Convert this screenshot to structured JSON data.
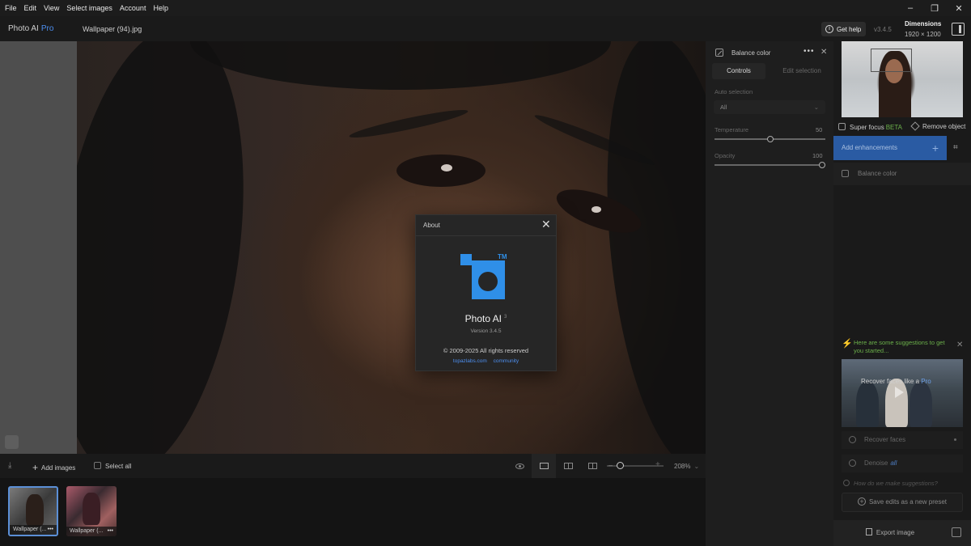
{
  "menu": [
    "File",
    "Edit",
    "View",
    "Select images",
    "Account",
    "Help"
  ],
  "window_controls": {
    "minimize": "–",
    "restore": "❐",
    "close": "✕"
  },
  "titlebar": {
    "app_name": "Photo AI",
    "app_tier": "Pro",
    "file_name": "Wallpaper (94).jpg",
    "get_help": "Get help",
    "version": "v3.4.5",
    "dimensions_label": "Dimensions",
    "dimensions_value": "1920 × 1200"
  },
  "bottombar": {
    "add_images": "Add images",
    "select_all": "Select all",
    "zoom": "208%",
    "zoom_level": 0.2
  },
  "thumbnails": [
    {
      "label": "Wallpaper (...",
      "more": "•••",
      "selected": true
    },
    {
      "label": "Wallpaper (...",
      "more": "•••",
      "selected": false
    }
  ],
  "balance_panel": {
    "title": "Balance color",
    "more": "•••",
    "close": "✕",
    "tabs": [
      "Controls",
      "Edit selection"
    ],
    "auto_selection_label": "Auto selection",
    "auto_selection_value": "All",
    "temperature_label": "Temperature",
    "temperature_value": "50",
    "temperature_level": 0.5,
    "opacity_label": "Opacity",
    "opacity_value": "100",
    "opacity_level": 1.0
  },
  "right_panel": {
    "super_focus": "Super focus",
    "super_focus_badge": "BETA",
    "remove_object": "Remove object",
    "add_enhancements": "Add enhancements",
    "enhancement_item": "Balance color",
    "suggestions_text": "Here are some suggestions to get you started...",
    "video_title": "Recover faces like a",
    "video_title_pro": "Pro",
    "suggestions": [
      "Recover faces",
      "Denoise"
    ],
    "denoise_tag": "all",
    "how_suggestions": "How do we make suggestions?",
    "save_preset": "Save edits as a new preset",
    "export": "Export image"
  },
  "about": {
    "title": "About",
    "close": "✕",
    "trademark": "TM",
    "product": "Photo AI",
    "product_sup": "3",
    "version": "Version 3.4.5",
    "copyright": "© 2009-2025 All rights reserved",
    "link_site": "topazlabs.com",
    "link_community": "community"
  },
  "colors": {
    "accent": "#4d8ff0",
    "add_enhancements_bg": "#2a5ba3",
    "suggestion_green": "#6bb04a",
    "logo_blue": "#2f8fe8"
  }
}
